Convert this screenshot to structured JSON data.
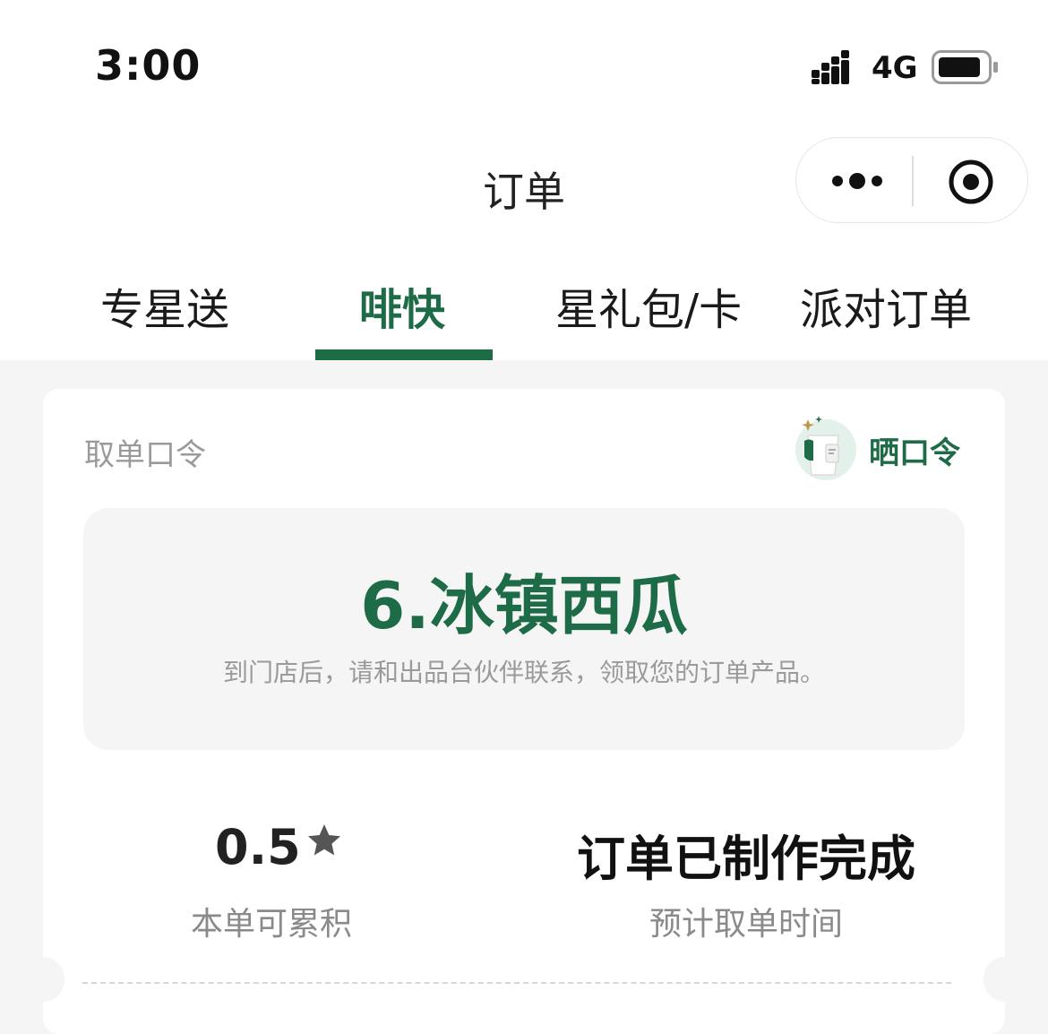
{
  "status_bar": {
    "time": "3:00",
    "network": "4G"
  },
  "nav": {
    "title": "订单"
  },
  "tabs": [
    {
      "label": "专星送",
      "active": false
    },
    {
      "label": "啡快",
      "active": true
    },
    {
      "label": "星礼包/卡",
      "active": false
    },
    {
      "label": "派对订单",
      "active": false
    }
  ],
  "card": {
    "label": "取单口令",
    "share_label": "晒口令",
    "pickup_code": "6.冰镇西瓜",
    "pickup_hint": "到门店后，请和出品台伙伴联系，领取您的订单产品。",
    "stars": {
      "value": "0.5",
      "label": "本单可累积"
    },
    "status": {
      "value": "订单已制作完成",
      "label": "预计取单时间"
    }
  },
  "colors": {
    "brand_green": "#1e6b48",
    "background": "#f5f5f5",
    "muted_text": "#9a9a9a"
  },
  "icons": {
    "signal": "cellular-signal-icon",
    "battery": "battery-icon",
    "more": "more-dots-icon",
    "close": "mini-program-close-icon",
    "share": "share-cup-icon",
    "star": "star-icon"
  }
}
